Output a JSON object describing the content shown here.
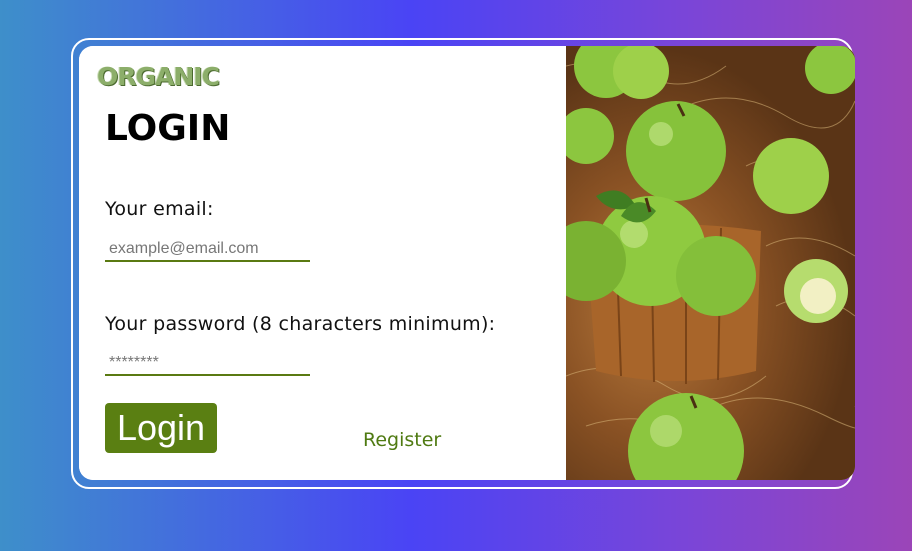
{
  "brand": {
    "logo_text": "ORGANIC"
  },
  "form": {
    "title": "LOGIN",
    "email_label": "Your email:",
    "email_placeholder": "example@email.com",
    "password_label": "Your password (8 characters minimum):",
    "password_placeholder": "********",
    "login_button": "Login",
    "register_link": "Register"
  },
  "colors": {
    "accent": "#5a7f12",
    "link": "#4f7a12",
    "background_start": "#3e8fca",
    "background_end": "#9b45b8"
  },
  "image": {
    "subject": "green apples in wooden bucket"
  }
}
